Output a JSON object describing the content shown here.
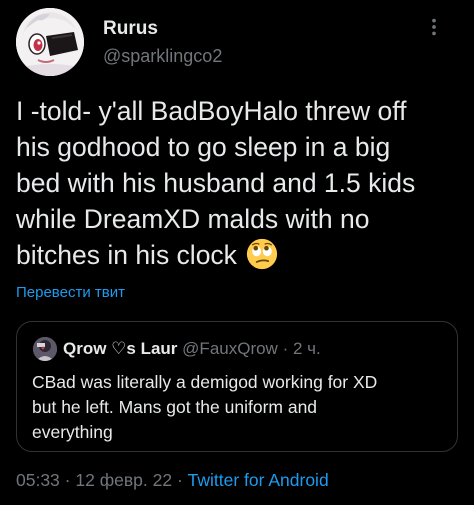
{
  "author": {
    "display_name": "Rurus",
    "handle": "@sparklingco2"
  },
  "tweet": {
    "text_lines": [
      "I -told- y'all BadBoyHalo threw off",
      "his godhood to go sleep in a big",
      "bed with his husband and 1.5 kids",
      "while DreamXD malds with no",
      "bitches in his clock"
    ],
    "emoji": "face-with-rolling-eyes"
  },
  "translate_label": "Перевести твит",
  "quote": {
    "display_name": "Qrow ♡s Laur",
    "handle": "@FauxQrow",
    "separator": "·",
    "time": "2 ч.",
    "text_lines": [
      "CBad was literally a demigod working for XD",
      "but he left. Mans got the uniform and",
      "everything"
    ]
  },
  "meta": {
    "time": "05:33",
    "separator": "·",
    "date": "12 февр. 22",
    "source": "Twitter for Android"
  },
  "colors": {
    "background": "#000000",
    "text": "#e7e9ea",
    "secondary": "#71767b",
    "accent": "#1d9bf0",
    "border": "#2f3336"
  },
  "icons": {
    "more": "more-horizontal-icon",
    "emoji": "rolling-eyes-emoji"
  }
}
